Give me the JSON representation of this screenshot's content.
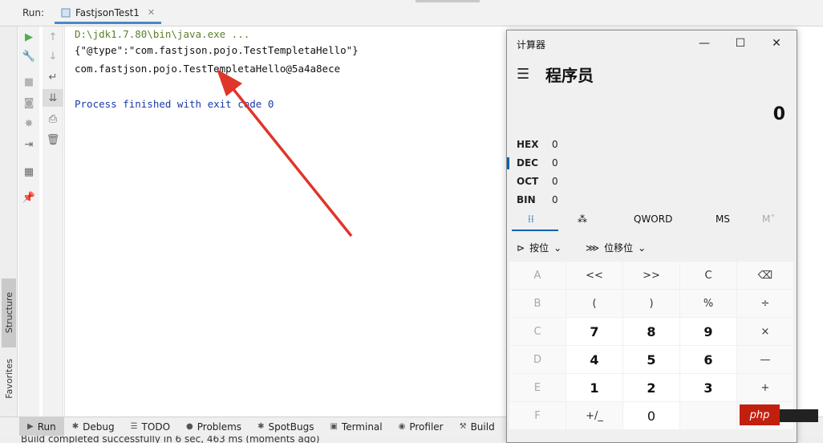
{
  "header": {
    "run_label": "Run:",
    "tab_label": "FastjsonTest1"
  },
  "side_tabs": {
    "structure": "Structure",
    "favorites": "Favorites"
  },
  "console": {
    "lines": [
      "D:\\jdk1.7.80\\bin\\java.exe ...",
      "{\"@type\":\"com.fastjson.pojo.TestTempletaHello\"}",
      "com.fastjson.pojo.TestTempletaHello@5a4a8ece",
      "Process finished with exit code 0"
    ]
  },
  "bottom_tabs": [
    "Run",
    "Debug",
    "TODO",
    "Problems",
    "SpotBugs",
    "Terminal",
    "Profiler",
    "Build"
  ],
  "status_text": "Build completed successfully in 6 sec, 463 ms (moments ago)",
  "calc": {
    "title": "计算器",
    "mode": "程序员",
    "display": "0",
    "radix": [
      {
        "label": "HEX",
        "value": "0"
      },
      {
        "label": "DEC",
        "value": "0"
      },
      {
        "label": "OCT",
        "value": "0"
      },
      {
        "label": "BIN",
        "value": "0"
      }
    ],
    "tabs": {
      "qword": "QWORD",
      "ms": "MS",
      "mplus": "M˅"
    },
    "bitwise": "按位",
    "bitshift": "位移位",
    "keys": [
      [
        "A",
        "<<",
        ">>",
        "C",
        "⌫"
      ],
      [
        "B",
        "(",
        ")",
        "%",
        "÷"
      ],
      [
        "C",
        "7",
        "8",
        "9",
        "×"
      ],
      [
        "D",
        "4",
        "5",
        "6",
        "—"
      ],
      [
        "E",
        "1",
        "2",
        "3",
        "+"
      ],
      [
        "F",
        "+/_",
        "0",
        "",
        ""
      ]
    ]
  },
  "watermark": "php"
}
